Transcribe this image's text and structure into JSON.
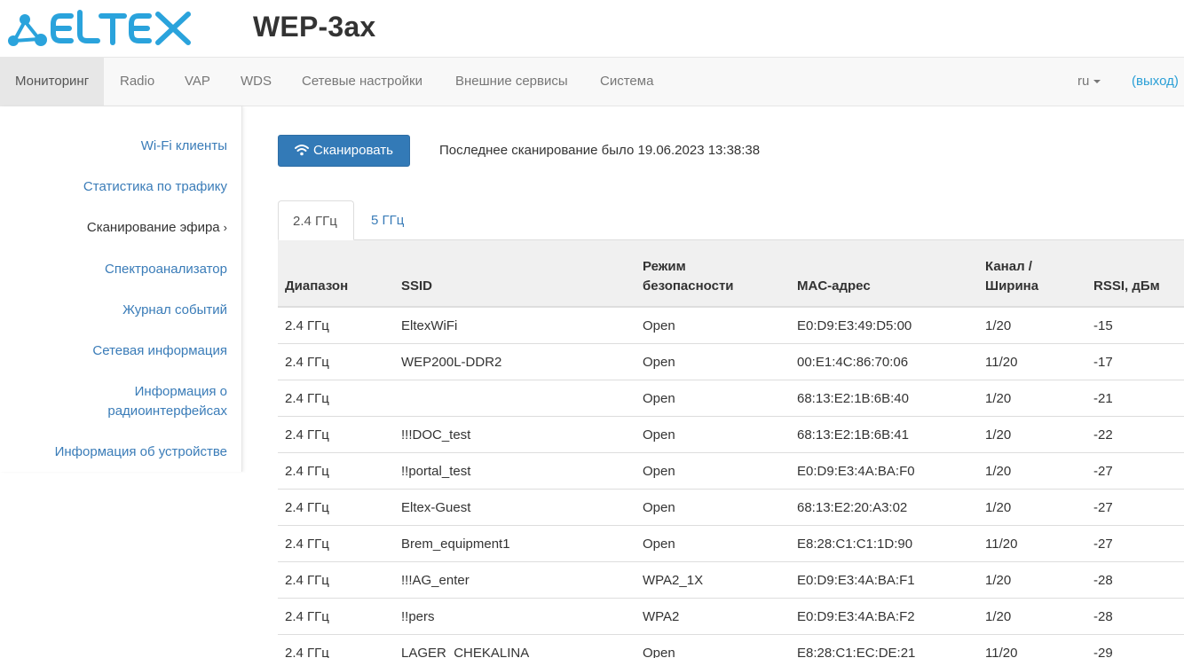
{
  "header": {
    "logo_text": "ELTEX",
    "product": "WEP-3ax"
  },
  "nav": {
    "items": [
      {
        "label": "Мониторинг",
        "active": true
      },
      {
        "label": "Radio"
      },
      {
        "label": "VAP"
      },
      {
        "label": "WDS"
      },
      {
        "label": "Сетевые настройки"
      },
      {
        "label": "Внешние сервисы"
      },
      {
        "label": "Система"
      }
    ],
    "language": "ru",
    "logout": "(выход)"
  },
  "sidebar": {
    "items": [
      {
        "label": "Wi-Fi клиенты"
      },
      {
        "label": "Статистика по трафику"
      },
      {
        "label": "Сканирование эфира",
        "active": true
      },
      {
        "label": "Спектроанализатор"
      },
      {
        "label": "Журнал событий"
      },
      {
        "label": "Сетевая информация"
      },
      {
        "label_line1": "Информация о",
        "label_line2": "радиоинтерфейсах"
      },
      {
        "label": "Информация об устройстве"
      }
    ],
    "active_marker": "›"
  },
  "scan": {
    "button_label": "Сканировать",
    "last_scan": "Последнее сканирование было 19.06.2023 13:38:38"
  },
  "tabs": [
    {
      "label": "2.4 ГГц",
      "active": true
    },
    {
      "label": "5 ГГц"
    }
  ],
  "table": {
    "headers": {
      "band": "Диапазон",
      "ssid": "SSID",
      "security_line1": "Режим",
      "security_line2": "безопасности",
      "mac": "MAC-адрес",
      "channel_line1": "Канал /",
      "channel_line2": "Ширина",
      "rssi": "RSSI, дБм"
    },
    "rows": [
      {
        "band": "2.4 ГГц",
        "ssid": "EltexWiFi",
        "security": "Open",
        "mac": "E0:D9:E3:49:D5:00",
        "channel": "1/20",
        "rssi": "-15"
      },
      {
        "band": "2.4 ГГц",
        "ssid": "WEP200L-DDR2",
        "security": "Open",
        "mac": "00:E1:4C:86:70:06",
        "channel": "11/20",
        "rssi": "-17"
      },
      {
        "band": "2.4 ГГц",
        "ssid": "",
        "security": "Open",
        "mac": "68:13:E2:1B:6B:40",
        "channel": "1/20",
        "rssi": "-21"
      },
      {
        "band": "2.4 ГГц",
        "ssid": "!!!DOC_test",
        "security": "Open",
        "mac": "68:13:E2:1B:6B:41",
        "channel": "1/20",
        "rssi": "-22"
      },
      {
        "band": "2.4 ГГц",
        "ssid": "!!portal_test",
        "security": "Open",
        "mac": "E0:D9:E3:4A:BA:F0",
        "channel": "1/20",
        "rssi": "-27"
      },
      {
        "band": "2.4 ГГц",
        "ssid": "Eltex-Guest",
        "security": "Open",
        "mac": "68:13:E2:20:A3:02",
        "channel": "1/20",
        "rssi": "-27"
      },
      {
        "band": "2.4 ГГц",
        "ssid": "Brem_equipment1",
        "security": "Open",
        "mac": "E8:28:C1:C1:1D:90",
        "channel": "11/20",
        "rssi": "-27"
      },
      {
        "band": "2.4 ГГц",
        "ssid": "!!!AG_enter",
        "security": "WPA2_1X",
        "mac": "E0:D9:E3:4A:BA:F1",
        "channel": "1/20",
        "rssi": "-28"
      },
      {
        "band": "2.4 ГГц",
        "ssid": "!!pers",
        "security": "WPA2",
        "mac": "E0:D9:E3:4A:BA:F2",
        "channel": "1/20",
        "rssi": "-28"
      },
      {
        "band": "2.4 ГГц",
        "ssid": "LAGER_CHEKALINA",
        "security": "Open",
        "mac": "E8:28:C1:EC:DE:21",
        "channel": "11/20",
        "rssi": "-29"
      }
    ]
  },
  "colors": {
    "brand": "#2a9fd6",
    "primary_button": "#337ab7",
    "link": "#3a7cb8"
  }
}
